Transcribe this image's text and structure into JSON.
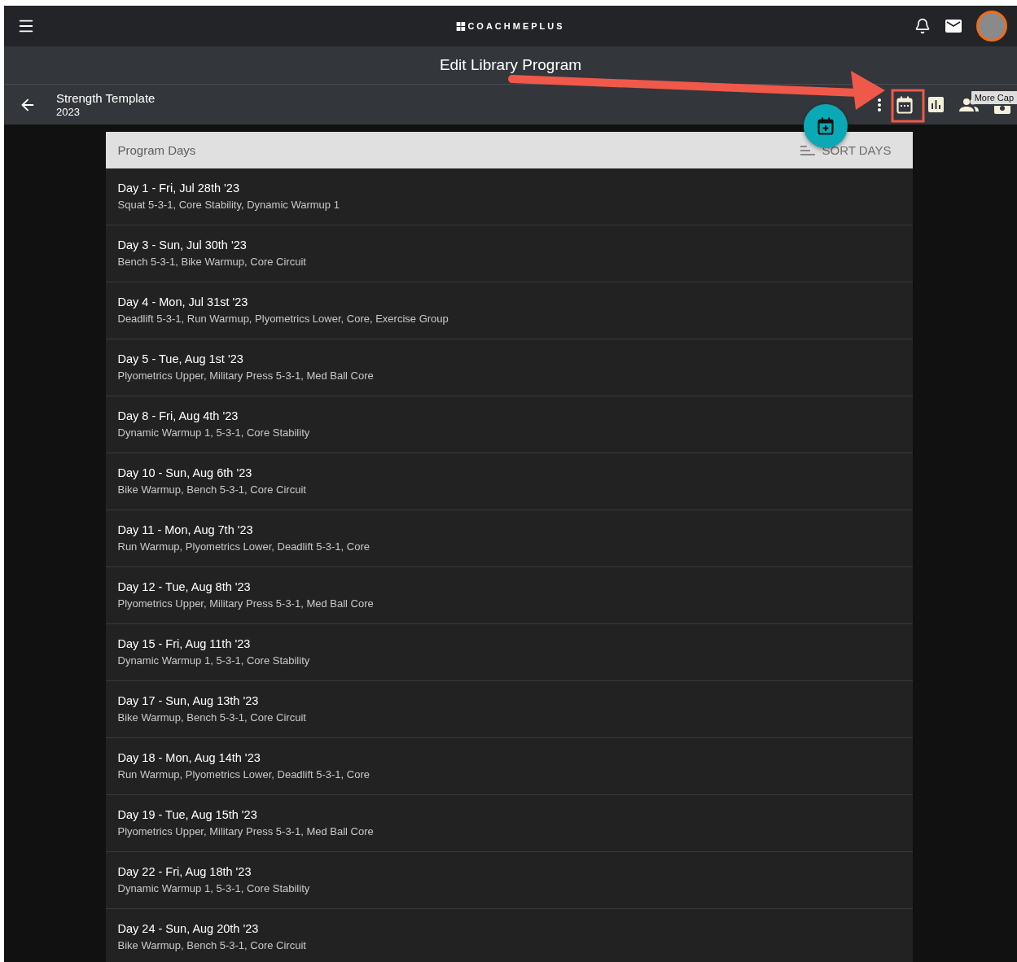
{
  "topbar": {
    "logo": "COACHMEPLUS"
  },
  "page_title": "Edit Library Program",
  "program": {
    "title": "Strength Template",
    "subtitle": "2023"
  },
  "tooltip": "More Cap",
  "panel": {
    "title": "Program Days",
    "sort_button": "SORT DAYS"
  },
  "days": [
    {
      "title": "Day 1 - Fri, Jul 28th '23",
      "exercises": "Squat 5-3-1, Core Stability, Dynamic Warmup 1"
    },
    {
      "title": "Day 3 - Sun, Jul 30th '23",
      "exercises": "Bench 5-3-1, Bike Warmup, Core Circuit"
    },
    {
      "title": "Day 4 - Mon, Jul 31st '23",
      "exercises": "Deadlift 5-3-1, Run Warmup, Plyometrics Lower, Core, Exercise Group"
    },
    {
      "title": "Day 5 - Tue, Aug 1st '23",
      "exercises": "Plyometrics Upper, Military Press 5-3-1, Med Ball Core"
    },
    {
      "title": "Day 8 - Fri, Aug 4th '23",
      "exercises": "Dynamic Warmup 1, 5-3-1, Core Stability"
    },
    {
      "title": "Day 10 - Sun, Aug 6th '23",
      "exercises": "Bike Warmup, Bench 5-3-1, Core Circuit"
    },
    {
      "title": "Day 11 - Mon, Aug 7th '23",
      "exercises": "Run Warmup, Plyometrics Lower, Deadlift 5-3-1, Core"
    },
    {
      "title": "Day 12 - Tue, Aug 8th '23",
      "exercises": "Plyometrics Upper, Military Press 5-3-1, Med Ball Core"
    },
    {
      "title": "Day 15 - Fri, Aug 11th '23",
      "exercises": "Dynamic Warmup 1, 5-3-1, Core Stability"
    },
    {
      "title": "Day 17 - Sun, Aug 13th '23",
      "exercises": "Bike Warmup, Bench 5-3-1, Core Circuit"
    },
    {
      "title": "Day 18 - Mon, Aug 14th '23",
      "exercises": "Run Warmup, Plyometrics Lower, Deadlift 5-3-1, Core"
    },
    {
      "title": "Day 19 - Tue, Aug 15th '23",
      "exercises": "Plyometrics Upper, Military Press 5-3-1, Med Ball Core"
    },
    {
      "title": "Day 22 - Fri, Aug 18th '23",
      "exercises": "Dynamic Warmup 1, 5-3-1, Core Stability"
    },
    {
      "title": "Day 24 - Sun, Aug 20th '23",
      "exercises": "Bike Warmup, Bench 5-3-1, Core Circuit"
    }
  ]
}
